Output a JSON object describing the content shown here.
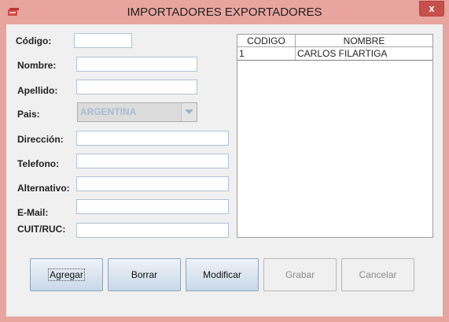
{
  "window": {
    "title": "IMPORTADORES EXPORTADORES",
    "close_glyph": "x"
  },
  "form": {
    "codigo": {
      "label": "Código:",
      "value": ""
    },
    "nombre": {
      "label": "Nombre:",
      "value": ""
    },
    "apellido": {
      "label": "Apellido:",
      "value": ""
    },
    "pais": {
      "label": "Pais:",
      "selected": "ARGENTINA"
    },
    "direccion": {
      "label": "Dirección:",
      "value": ""
    },
    "telefono": {
      "label": "Telefono:",
      "value": ""
    },
    "alternativo": {
      "label": "Alternativo:",
      "value": ""
    },
    "email": {
      "label": "E-Mail:",
      "value": ""
    },
    "cuit": {
      "label": "CUIT/RUC:",
      "value": ""
    }
  },
  "table": {
    "columns": [
      "CODIGO",
      "NOMBRE"
    ],
    "rows": [
      {
        "codigo": "1",
        "nombre": "CARLOS  FILARTIGA"
      }
    ]
  },
  "buttons": {
    "agregar": "Agregar",
    "borrar": "Borrar",
    "modificar": "Modificar",
    "grabar": "Grabar",
    "cancelar": "Cancelar"
  },
  "colors": {
    "titlebar": "#e8a49f",
    "close": "#c7504b",
    "disabled_text": "#a8bcd2"
  }
}
